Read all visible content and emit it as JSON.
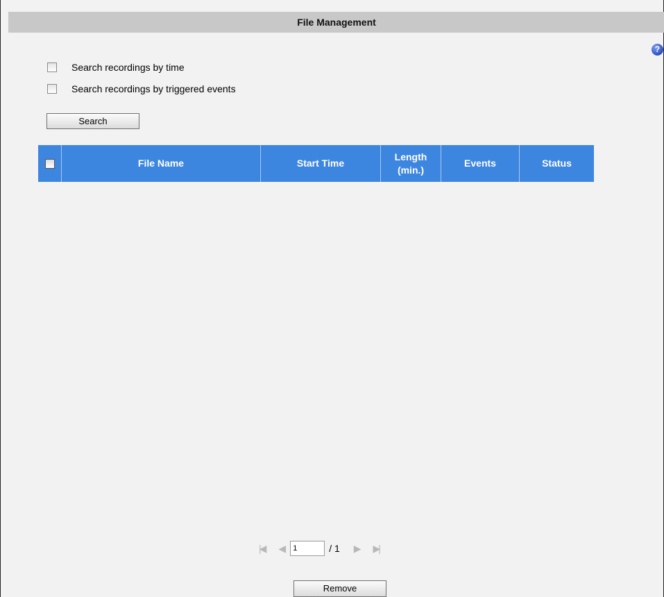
{
  "panel": {
    "title": "File Management"
  },
  "help": {
    "icon": "question-circle-icon",
    "glyph": "?"
  },
  "search_options": [
    {
      "label": "Search recordings by time",
      "checked": false
    },
    {
      "label": "Search recordings by triggered events",
      "checked": false
    }
  ],
  "search_button": {
    "label": "Search"
  },
  "grid": {
    "columns": [
      {
        "label": ""
      },
      {
        "label": "File Name"
      },
      {
        "label": "Start Time"
      },
      {
        "label": "Length (min.)"
      },
      {
        "label": "Events"
      },
      {
        "label": "Status"
      }
    ],
    "rows": []
  },
  "pager": {
    "first_icon": "first-page-icon",
    "prev_icon": "prev-page-icon",
    "next_icon": "next-page-icon",
    "last_icon": "last-page-icon",
    "current_page": "1",
    "total_label": "/ 1"
  },
  "remove_button": {
    "label": "Remove"
  },
  "colors": {
    "title_bar": "#c8c8c8",
    "grid_header": "#3d86e0",
    "background": "#f2f2f2"
  }
}
